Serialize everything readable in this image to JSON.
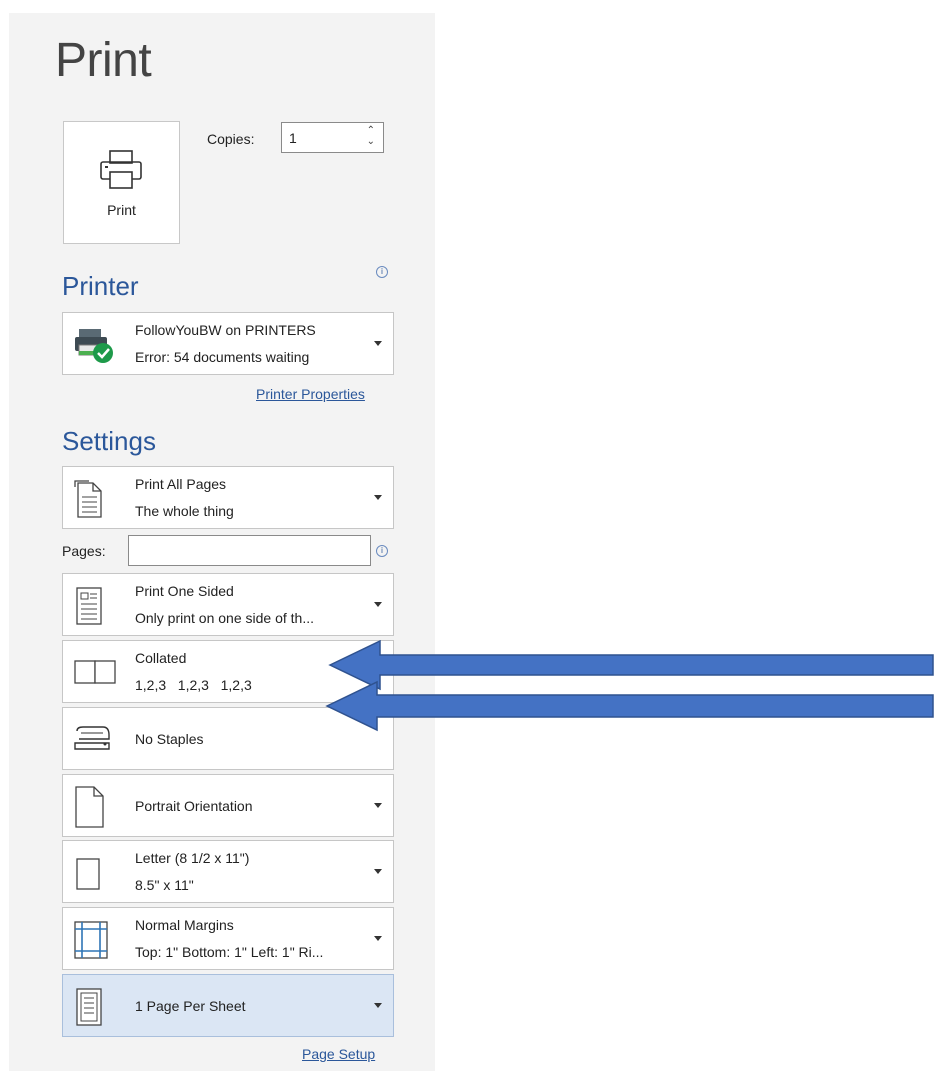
{
  "backstage": {
    "title": "Print",
    "print_button_label": "Print",
    "copies_label": "Copies:",
    "copies_value": "1"
  },
  "printer": {
    "heading": "Printer",
    "name": "FollowYouBW on PRINTERS",
    "status": "Error: 54 documents waiting",
    "properties_link": "Printer Properties"
  },
  "settings": {
    "heading": "Settings",
    "pages_label": "Pages:",
    "pages_value": "",
    "items": [
      {
        "line1": "Print All Pages",
        "line2": "The whole thing",
        "icon": "document-pages-icon"
      },
      {
        "line1": "Print One Sided",
        "line2": "Only print on one side of th...",
        "icon": "one-sided-icon"
      },
      {
        "line1": "Collated",
        "line2": "1,2,3   1,2,3   1,2,3",
        "icon": "collated-icon"
      },
      {
        "line1": "No Staples",
        "line2": "",
        "icon": "staple-icon"
      },
      {
        "line1": "Portrait Orientation",
        "line2": "",
        "icon": "portrait-icon"
      },
      {
        "line1": "Letter (8 1/2 x 11\")",
        "line2": "8.5\" x 11\"",
        "icon": "paper-size-icon"
      },
      {
        "line1": "Normal Margins",
        "line2": "Top: 1\" Bottom: 1\" Left: 1\" Ri...",
        "icon": "margins-icon"
      },
      {
        "line1": "1 Page Per Sheet",
        "line2": "",
        "icon": "pages-per-sheet-icon"
      }
    ],
    "page_setup_link": "Page Setup"
  },
  "colors": {
    "accent": "#2b579a",
    "arrow_fill": "#4472c4",
    "arrow_stroke": "#2f528f",
    "panel": "#f3f3f3"
  }
}
